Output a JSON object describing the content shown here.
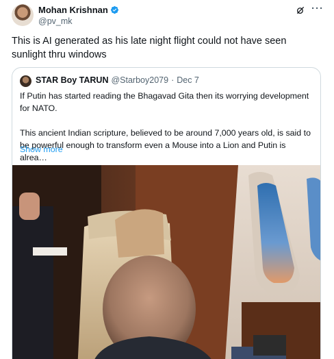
{
  "author": {
    "name": "Mohan Krishnan",
    "handle": "@pv_mk"
  },
  "tweet": {
    "text": "This is AI generated as his late night flight could not have seen sunlight thru windows"
  },
  "quoted": {
    "name": "STAR Boy TARUN",
    "handle": "@Starboy2079",
    "separator": "·",
    "date": "Dec 7",
    "paragraph1": "If Putin has started reading the Bhagavad Gita then its worrying development for NATO.",
    "paragraph2": "This ancient Indian scripture, believed to be around 7,000 years old, is said to be powerful enough to transform even a Mouse into a Lion and Putin is alrea…",
    "show_more": "Show more"
  },
  "icons": {
    "verified": "verified-badge-icon",
    "grok": "grok-icon",
    "more": "more-options-icon"
  },
  "colors": {
    "accent": "#1d9bf0",
    "secondary_text": "#536471",
    "border": "#cfd9de"
  }
}
